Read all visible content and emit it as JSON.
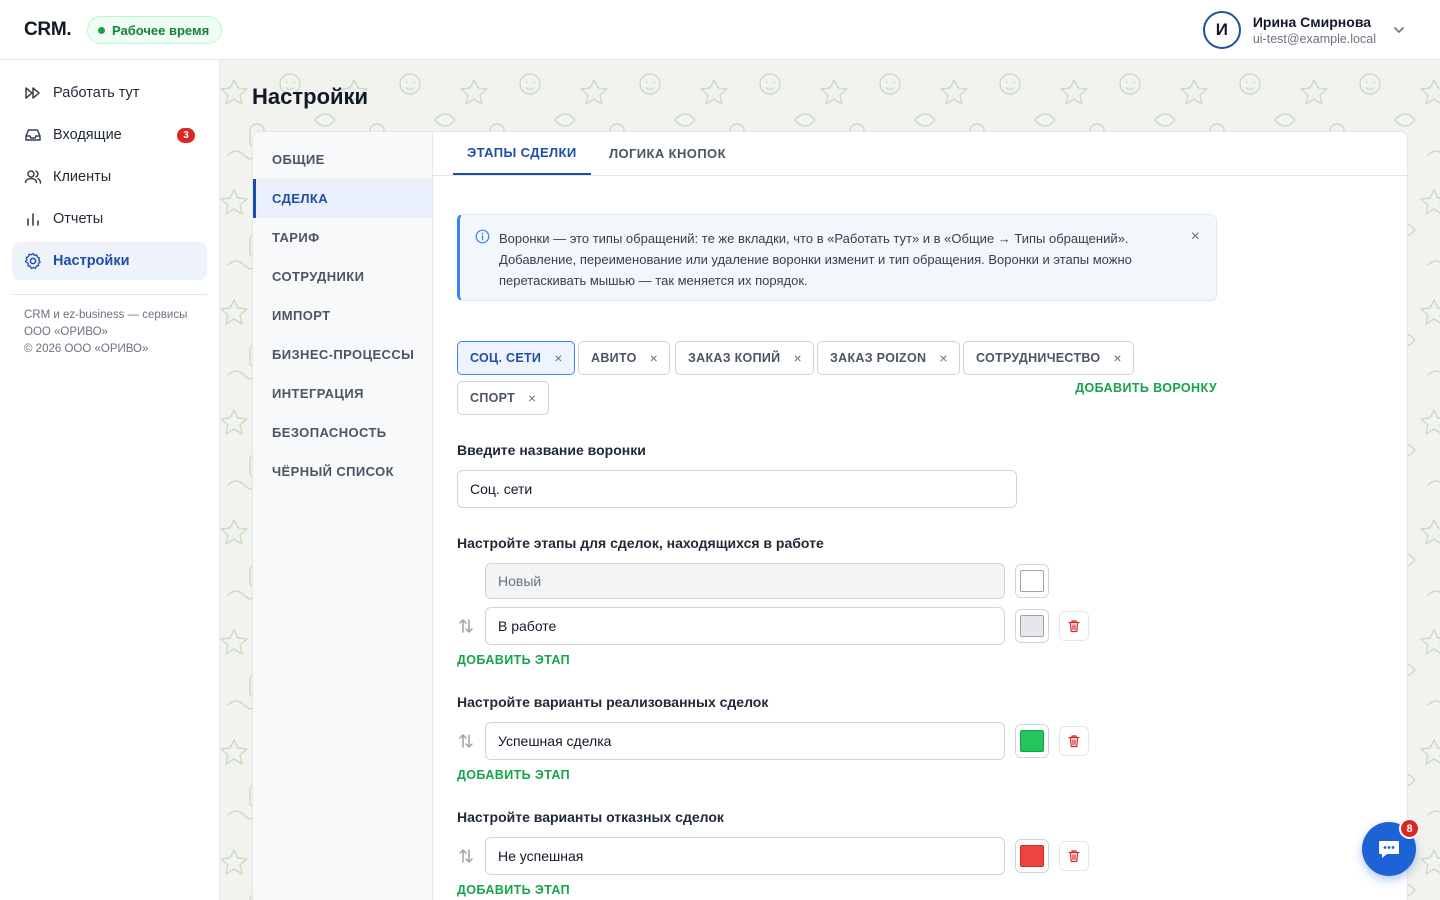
{
  "header": {
    "logo": "CRM.",
    "status_label": "Рабочее время",
    "user": {
      "initial": "И",
      "name": "Ирина Смирнова",
      "email": "ui-test@example.local"
    }
  },
  "sidebar": {
    "items": [
      {
        "label": "Работать тут",
        "icon": "fast-forward-icon"
      },
      {
        "label": "Входящие",
        "icon": "inbox-icon",
        "badge": "3"
      },
      {
        "label": "Клиенты",
        "icon": "users-icon"
      },
      {
        "label": "Отчеты",
        "icon": "bar-chart-icon"
      },
      {
        "label": "Настройки",
        "icon": "gear-icon",
        "active": true
      }
    ],
    "footer": [
      "CRM и ez-business — сервисы",
      "ООО «ОРИВО»",
      "© 2026 ООО «ОРИВО»"
    ]
  },
  "page": {
    "title": "Настройки"
  },
  "settings_nav": {
    "items": [
      "ОБЩИЕ",
      "СДЕЛКА",
      "ТАРИФ",
      "СОТРУДНИКИ",
      "ИМПОРТ",
      "БИЗНЕС-ПРОЦЕССЫ",
      "ИНТЕГРАЦИЯ",
      "БЕЗОПАСНОСТЬ",
      "ЧЁРНЫЙ СПИСОК"
    ],
    "active": "СДЕЛКА"
  },
  "tabs": {
    "items": [
      "ЭТАПЫ СДЕЛКИ",
      "ЛОГИКА КНОПОК"
    ],
    "active": "ЭТАПЫ СДЕЛКИ"
  },
  "info": {
    "text": "Воронки — это типы обращений: те же вкладки, что в «Работать тут» и в «Общие → Типы обращений». Добавление, переименование или удаление воронки изменит и тип обращения. Воронки и этапы можно перетаскивать мышью — так меняется их порядок.",
    "close": "×"
  },
  "funnels": {
    "items": [
      "СОЦ. СЕТИ",
      "АВИТО",
      "ЗАКАЗ КОПИЙ",
      "ЗАКАЗ POIZON",
      "СОТРУДНИЧЕСТВО",
      "СПОРТ"
    ],
    "active": "СОЦ. СЕТИ",
    "remove": "×",
    "add_label": "ДОБАВИТЬ ВОРОНКУ"
  },
  "funnel_name": {
    "label": "Введите название воронки",
    "value": "Соц. сети"
  },
  "stages_in_work": {
    "label": "Настройте этапы для сделок, находящихся в работе",
    "rows": [
      {
        "value": "Новый",
        "color": "#ffffff",
        "locked": true
      },
      {
        "value": "В работе",
        "color": "#e5e7eb",
        "locked": false
      }
    ],
    "add_label": "ДОБАВИТЬ ЭТАП"
  },
  "stages_success": {
    "label": "Настройте варианты реализованных сделок",
    "rows": [
      {
        "value": "Успешная сделка",
        "color": "#22c55e"
      }
    ],
    "add_label": "ДОБАВИТЬ ЭТАП"
  },
  "stages_fail": {
    "label": "Настройте варианты отказных сделок",
    "rows": [
      {
        "value": "Не успешная",
        "color": "#ef4444"
      }
    ],
    "add_label": "ДОБАВИТЬ ЭТАП"
  },
  "chat": {
    "badge": "8",
    "icon": "chat-icon"
  }
}
